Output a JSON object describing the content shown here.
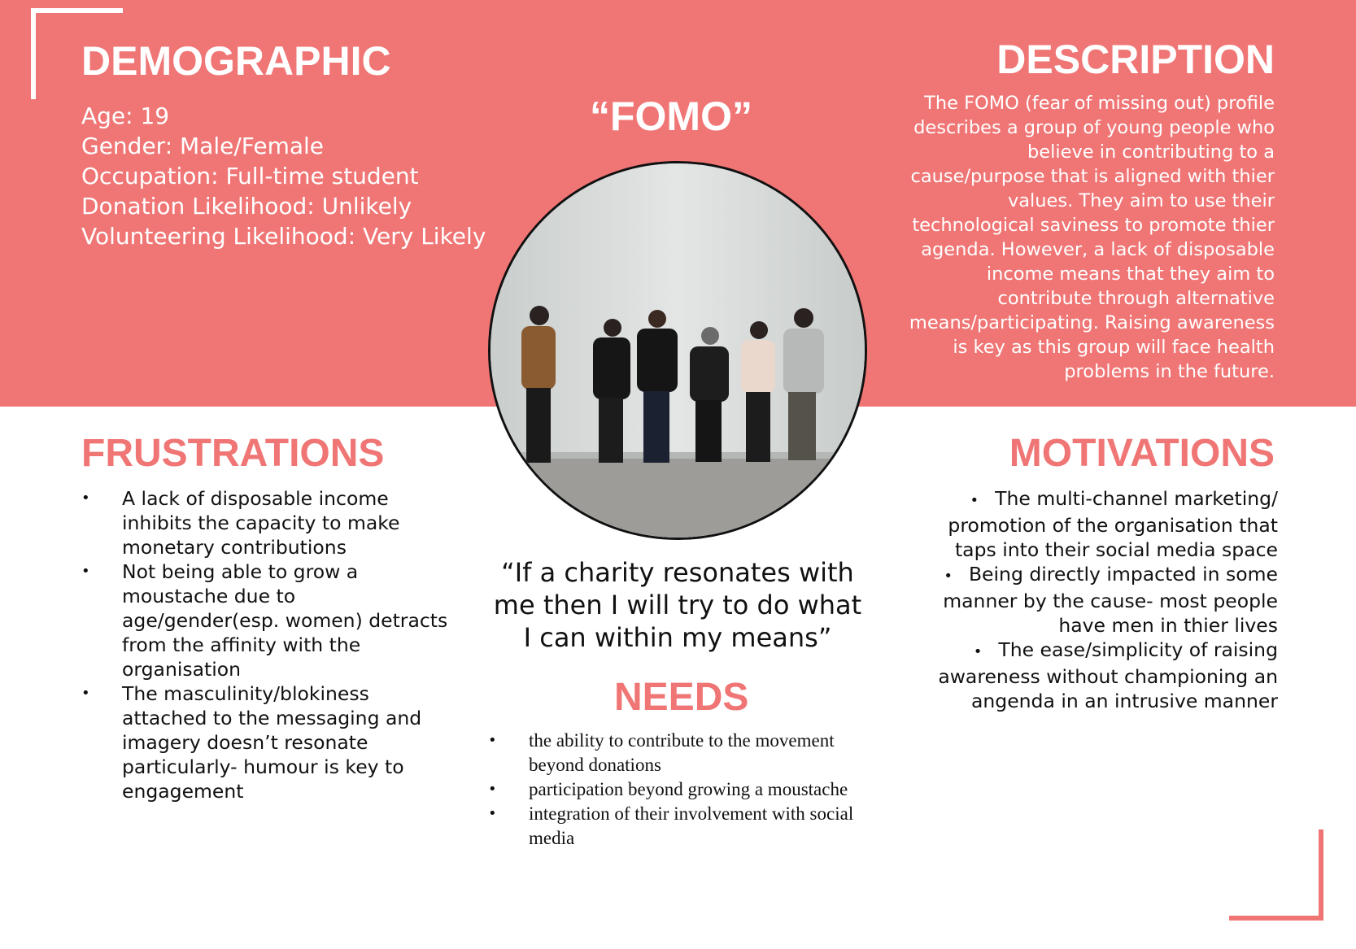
{
  "colors": {
    "accent": "#f07575",
    "text": "#111111",
    "on_accent": "#ffffff"
  },
  "demographic": {
    "title": "DEMOGRAPHIC",
    "lines": [
      "Age: 19",
      "Gender: Male/Female",
      "Occupation: Full-time student",
      "Donation Likelihood: Unlikely",
      "Volunteering Likelihood: Very Likely"
    ]
  },
  "persona": {
    "name": "“FOMO”",
    "photo_icon": "group-of-young-people-photo"
  },
  "description": {
    "title": "DESCRIPTION",
    "text": "The FOMO (fear of missing out) profile describes a group of young people who believe in contributing to a cause/purpose that is aligned with thier values.  They aim to use their technological saviness to promote thier agenda. However, a lack of disposable income means that they aim to contribute through alternative means/participating. Raising awareness is key as this group will face health problems in the future."
  },
  "frustrations": {
    "title": "FRUSTRATIONS",
    "items": [
      "A lack of disposable income inhibits the capacity to make monetary contributions",
      "Not being able to grow a moustache due to age/gender(esp. women) detracts from the affinity with the organisation",
      "The masculinity/blokiness attached to the messaging and imagery doesn’t resonate particularly- humour is key to engagement"
    ]
  },
  "quote": "“If a charity resonates with me then I will try to do what I can within my means”",
  "needs": {
    "title": "NEEDS",
    "items": [
      "the ability to contribute to the movement beyond donations",
      "participation beyond growing a moustache",
      "integration of their involvement with social media"
    ]
  },
  "motivations": {
    "title": "MOTIVATIONS",
    "items": [
      "The multi-channel marketing/ promotion of the organisation that taps into their social media space",
      "Being directly impacted in some manner by the cause- most people have men in thier lives",
      "The ease/simplicity of raising awareness without championing an angenda in an intrusive manner"
    ]
  }
}
